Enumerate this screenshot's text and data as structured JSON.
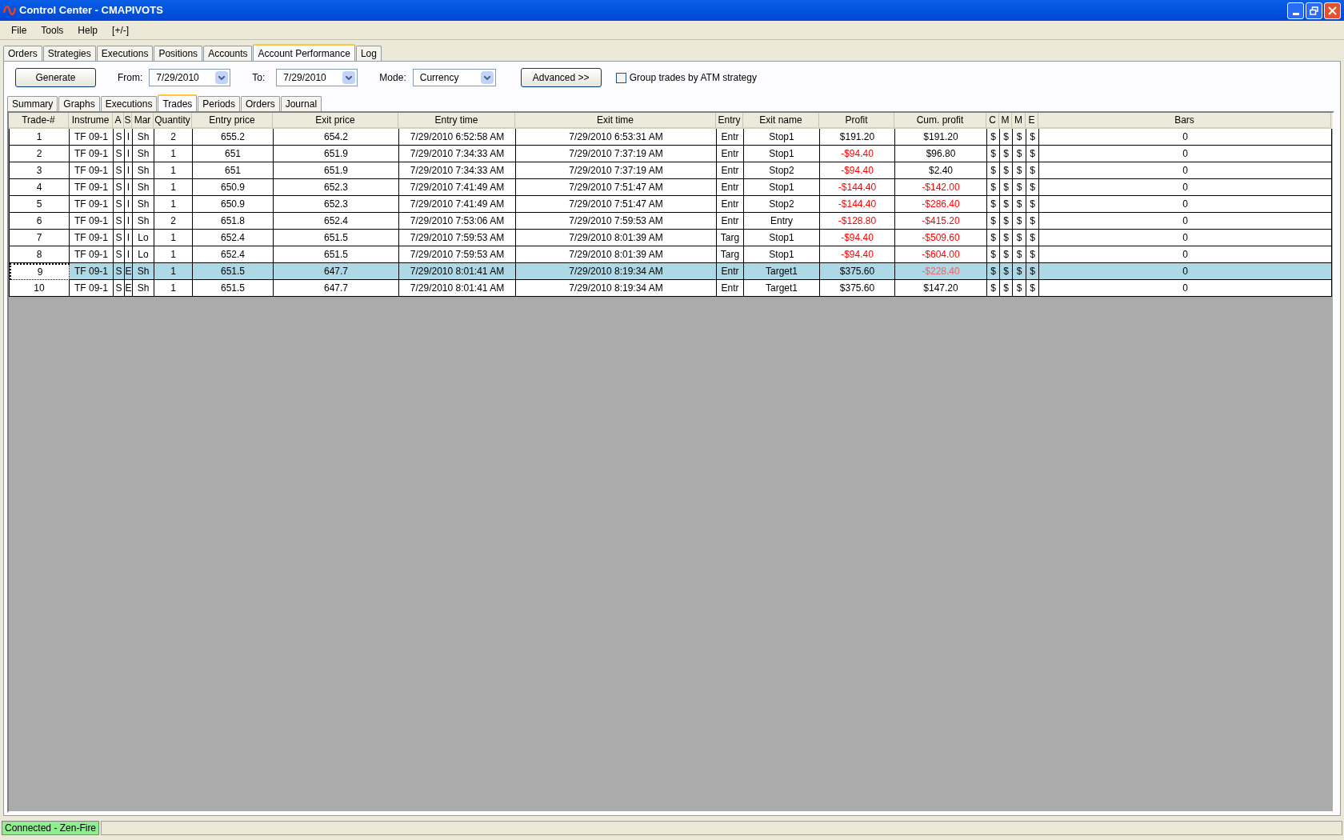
{
  "window": {
    "title": "Control Center - CMAPIVOTS"
  },
  "menu": [
    "File",
    "Tools",
    "Help",
    "[+/-]"
  ],
  "tabs": [
    {
      "label": "Orders",
      "selected": false
    },
    {
      "label": "Strategies",
      "selected": false
    },
    {
      "label": "Executions",
      "selected": false
    },
    {
      "label": "Positions",
      "selected": false
    },
    {
      "label": "Accounts",
      "selected": false
    },
    {
      "label": "Account Performance",
      "selected": true
    },
    {
      "label": "Log",
      "selected": false
    }
  ],
  "toolbar": {
    "generate": "Generate",
    "from_label": "From:",
    "from": "7/29/2010",
    "to_label": "To:",
    "to": "7/29/2010",
    "mode_label": "Mode:",
    "mode": "Currency",
    "advanced": "Advanced >>",
    "group": {
      "label": "Group trades by ATM strategy",
      "checked": false
    }
  },
  "subtabs": [
    {
      "label": "Summary",
      "selected": false
    },
    {
      "label": "Graphs",
      "selected": false
    },
    {
      "label": "Executions",
      "selected": false
    },
    {
      "label": "Trades",
      "selected": true
    },
    {
      "label": "Periods",
      "selected": false
    },
    {
      "label": "Orders",
      "selected": false
    },
    {
      "label": "Journal",
      "selected": false
    }
  ],
  "table": {
    "columns": [
      "Trade-#",
      "Instrume",
      "A",
      "S",
      "Mar",
      "Quantity",
      "Entry price",
      "Exit price",
      "Entry time",
      "Exit time",
      "Entry",
      "Exit name",
      "Profit",
      "Cum. profit",
      "C",
      "M",
      "M",
      "E",
      "Bars"
    ],
    "rows": [
      {
        "selected": false,
        "cells": [
          "1",
          "TF 09-1",
          "S",
          "I",
          "Sh",
          "2",
          "655.2",
          "654.2",
          "7/29/2010 6:52:58 AM",
          "7/29/2010 6:53:31 AM",
          "Entr",
          "Stop1"
        ],
        "profit": {
          "text": "$191.20",
          "loss": false
        },
        "cum_profit": {
          "text": "$191.20",
          "loss": false
        },
        "flags": [
          "$",
          "$",
          "$",
          "$"
        ],
        "bars": "0"
      },
      {
        "selected": false,
        "cells": [
          "2",
          "TF 09-1",
          "S",
          "I",
          "Sh",
          "1",
          "651",
          "651.9",
          "7/29/2010 7:34:33 AM",
          "7/29/2010 7:37:19 AM",
          "Entr",
          "Stop1"
        ],
        "profit": {
          "text": "-$94.40",
          "loss": true
        },
        "cum_profit": {
          "text": "$96.80",
          "loss": false
        },
        "flags": [
          "$",
          "$",
          "$",
          "$"
        ],
        "bars": "0"
      },
      {
        "selected": false,
        "cells": [
          "3",
          "TF 09-1",
          "S",
          "I",
          "Sh",
          "1",
          "651",
          "651.9",
          "7/29/2010 7:34:33 AM",
          "7/29/2010 7:37:19 AM",
          "Entr",
          "Stop2"
        ],
        "profit": {
          "text": "-$94.40",
          "loss": true
        },
        "cum_profit": {
          "text": "$2.40",
          "loss": false
        },
        "flags": [
          "$",
          "$",
          "$",
          "$"
        ],
        "bars": "0"
      },
      {
        "selected": false,
        "cells": [
          "4",
          "TF 09-1",
          "S",
          "I",
          "Sh",
          "1",
          "650.9",
          "652.3",
          "7/29/2010 7:41:49 AM",
          "7/29/2010 7:51:47 AM",
          "Entr",
          "Stop1"
        ],
        "profit": {
          "text": "-$144.40",
          "loss": true
        },
        "cum_profit": {
          "text": "-$142.00",
          "loss": true
        },
        "flags": [
          "$",
          "$",
          "$",
          "$"
        ],
        "bars": "0"
      },
      {
        "selected": false,
        "cells": [
          "5",
          "TF 09-1",
          "S",
          "I",
          "Sh",
          "1",
          "650.9",
          "652.3",
          "7/29/2010 7:41:49 AM",
          "7/29/2010 7:51:47 AM",
          "Entr",
          "Stop2"
        ],
        "profit": {
          "text": "-$144.40",
          "loss": true
        },
        "cum_profit": {
          "text": "-$286.40",
          "loss": true
        },
        "flags": [
          "$",
          "$",
          "$",
          "$"
        ],
        "bars": "0"
      },
      {
        "selected": false,
        "cells": [
          "6",
          "TF 09-1",
          "S",
          "I",
          "Sh",
          "2",
          "651.8",
          "652.4",
          "7/29/2010 7:53:06 AM",
          "7/29/2010 7:59:53 AM",
          "Entr",
          "Entry"
        ],
        "profit": {
          "text": "-$128.80",
          "loss": true
        },
        "cum_profit": {
          "text": "-$415.20",
          "loss": true
        },
        "flags": [
          "$",
          "$",
          "$",
          "$"
        ],
        "bars": "0"
      },
      {
        "selected": false,
        "cells": [
          "7",
          "TF 09-1",
          "S",
          "I",
          "Lo",
          "1",
          "652.4",
          "651.5",
          "7/29/2010 7:59:53 AM",
          "7/29/2010 8:01:39 AM",
          "Targ",
          "Stop1"
        ],
        "profit": {
          "text": "-$94.40",
          "loss": true
        },
        "cum_profit": {
          "text": "-$509.60",
          "loss": true
        },
        "flags": [
          "$",
          "$",
          "$",
          "$"
        ],
        "bars": "0"
      },
      {
        "selected": false,
        "cells": [
          "8",
          "TF 09-1",
          "S",
          "I",
          "Lo",
          "1",
          "652.4",
          "651.5",
          "7/29/2010 7:59:53 AM",
          "7/29/2010 8:01:39 AM",
          "Targ",
          "Stop1"
        ],
        "profit": {
          "text": "-$94.40",
          "loss": true
        },
        "cum_profit": {
          "text": "-$604.00",
          "loss": true
        },
        "flags": [
          "$",
          "$",
          "$",
          "$"
        ],
        "bars": "0"
      },
      {
        "selected": true,
        "cells": [
          "9",
          "TF 09-1",
          "S",
          "E",
          "Sh",
          "1",
          "651.5",
          "647.7",
          "7/29/2010 8:01:41 AM",
          "7/29/2010 8:19:34 AM",
          "Entr",
          "Target1"
        ],
        "profit": {
          "text": "$375.60",
          "loss": false
        },
        "cum_profit": {
          "text": "-$228.40",
          "loss": true
        },
        "flags": [
          "$",
          "$",
          "$",
          "$"
        ],
        "bars": "0"
      },
      {
        "selected": false,
        "cells": [
          "10",
          "TF 09-1",
          "S",
          "E",
          "Sh",
          "1",
          "651.5",
          "647.7",
          "7/29/2010 8:01:41 AM",
          "7/29/2010 8:19:34 AM",
          "Entr",
          "Target1"
        ],
        "profit": {
          "text": "$375.60",
          "loss": false
        },
        "cum_profit": {
          "text": "$147.20",
          "loss": false
        },
        "flags": [
          "$",
          "$",
          "$",
          "$"
        ],
        "bars": "0"
      }
    ]
  },
  "status_bar": {
    "connection": "Connected - Zen-Fire"
  }
}
